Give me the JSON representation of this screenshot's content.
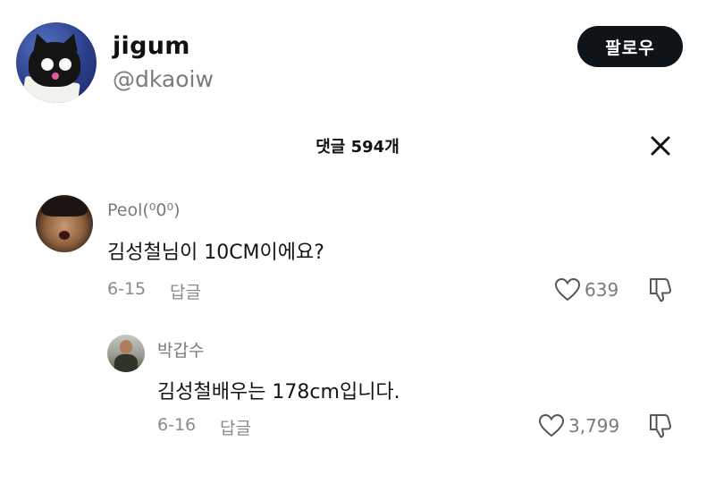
{
  "header": {
    "display_name": "jigum",
    "handle": "@dkaoiw",
    "follow_label": "팔로우"
  },
  "comments_panel": {
    "title": "댓글 594개"
  },
  "comments": [
    {
      "author": "Peol(⁰0⁰)",
      "text": "김성철님이 10CM이에요?",
      "date": "6-15",
      "reply_label": "답글",
      "likes": "639"
    },
    {
      "author": "박갑수",
      "text": "김성철배우는 178cm입니다.",
      "date": "6-16",
      "reply_label": "답글",
      "likes": "3,799"
    }
  ],
  "icons": {
    "close": "close-icon",
    "like": "heart-icon",
    "dislike": "thumbs-down-icon"
  },
  "colors": {
    "follow_button_bg": "#0f1419",
    "follow_button_text": "#ffffff",
    "secondary_text": "#8a8a8a"
  }
}
